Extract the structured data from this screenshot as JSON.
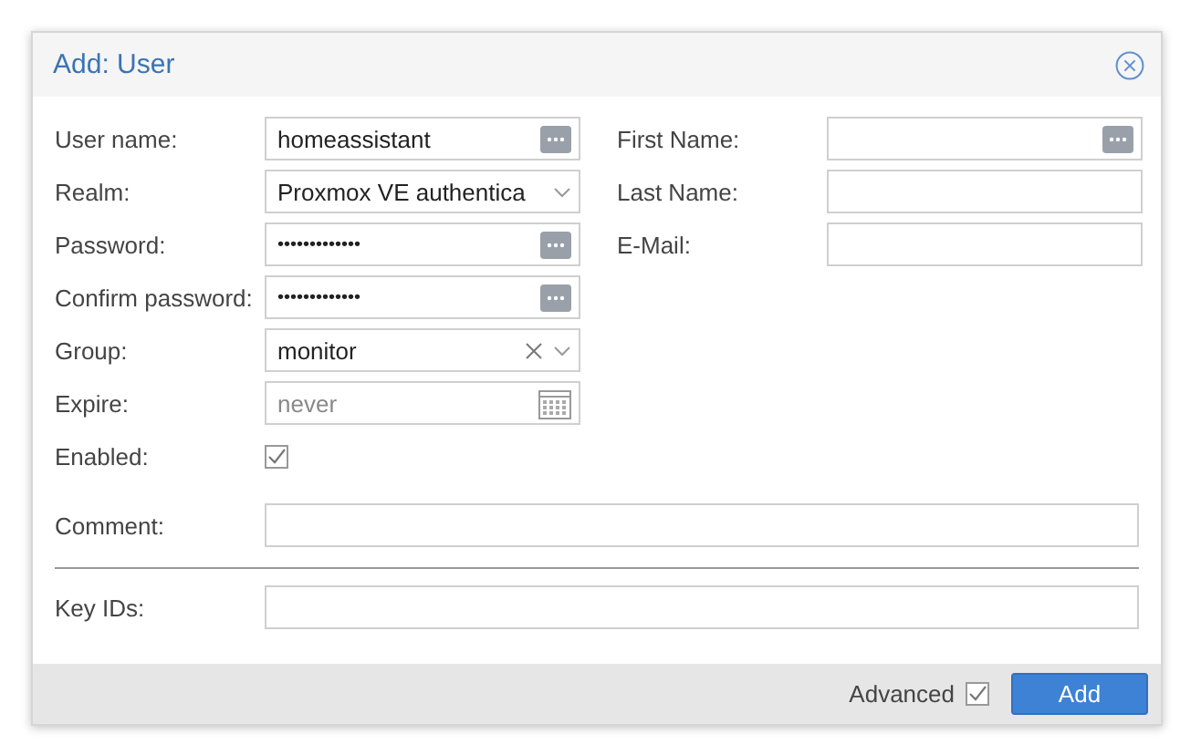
{
  "window": {
    "title": "Add: User"
  },
  "left_fields": [
    {
      "label": "User name:",
      "kind": "text",
      "value": "homeassistant",
      "ellipsis_button": true
    },
    {
      "label": "Realm:",
      "kind": "select",
      "value": "Proxmox VE authentica",
      "clearable": false
    },
    {
      "label": "Password:",
      "kind": "password",
      "value": "•••••••••••••",
      "ellipsis_button": true
    },
    {
      "label": "Confirm password:",
      "kind": "password",
      "value": "•••••••••••••",
      "ellipsis_button": true
    },
    {
      "label": "Group:",
      "kind": "select",
      "value": "monitor",
      "clearable": true
    },
    {
      "label": "Expire:",
      "kind": "date",
      "placeholder": "never"
    },
    {
      "label": "Enabled:",
      "kind": "checkbox",
      "checked": true
    }
  ],
  "right_fields": [
    {
      "label": "First Name:",
      "kind": "text",
      "ellipsis_button": true
    },
    {
      "label": "Last Name:",
      "kind": "text",
      "ellipsis_button": false
    },
    {
      "label": "E-Mail:",
      "kind": "text",
      "ellipsis_button": false
    }
  ],
  "comment": {
    "label": "Comment:"
  },
  "key_ids": {
    "label": "Key IDs:"
  },
  "footer": {
    "advanced": {
      "label": "Advanced",
      "checked": true
    },
    "button": "Add"
  }
}
